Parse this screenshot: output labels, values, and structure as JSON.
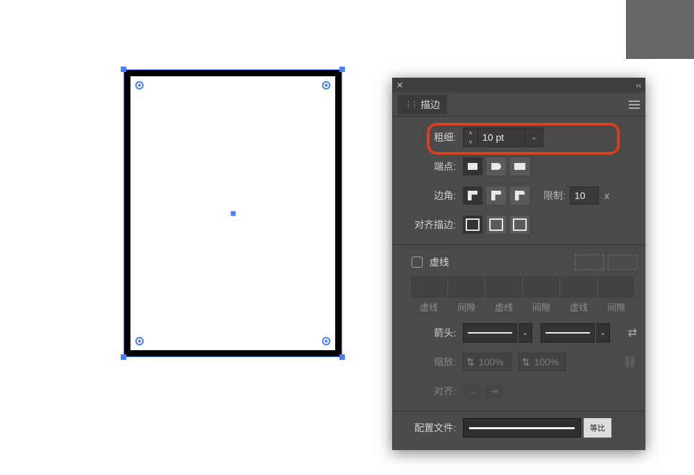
{
  "panel": {
    "title": "描边",
    "weight_label": "粗细:",
    "weight_value": "10 pt",
    "cap_label": "端点:",
    "join_label": "边角:",
    "miter_label": "限制:",
    "miter_value": "10",
    "miter_suffix": "x",
    "align_stroke_label": "对齐描边:",
    "dashed_label": "虚线",
    "dash_labels": [
      "虚线",
      "间隙",
      "虚线",
      "间隙",
      "虚线",
      "间隙"
    ],
    "arrow_label": "箭头:",
    "scale_label": "缩放:",
    "scale_a": "100%",
    "scale_b": "100%",
    "align_label": "对齐:",
    "profile_label": "配置文件:",
    "profile_btn": "等比"
  }
}
